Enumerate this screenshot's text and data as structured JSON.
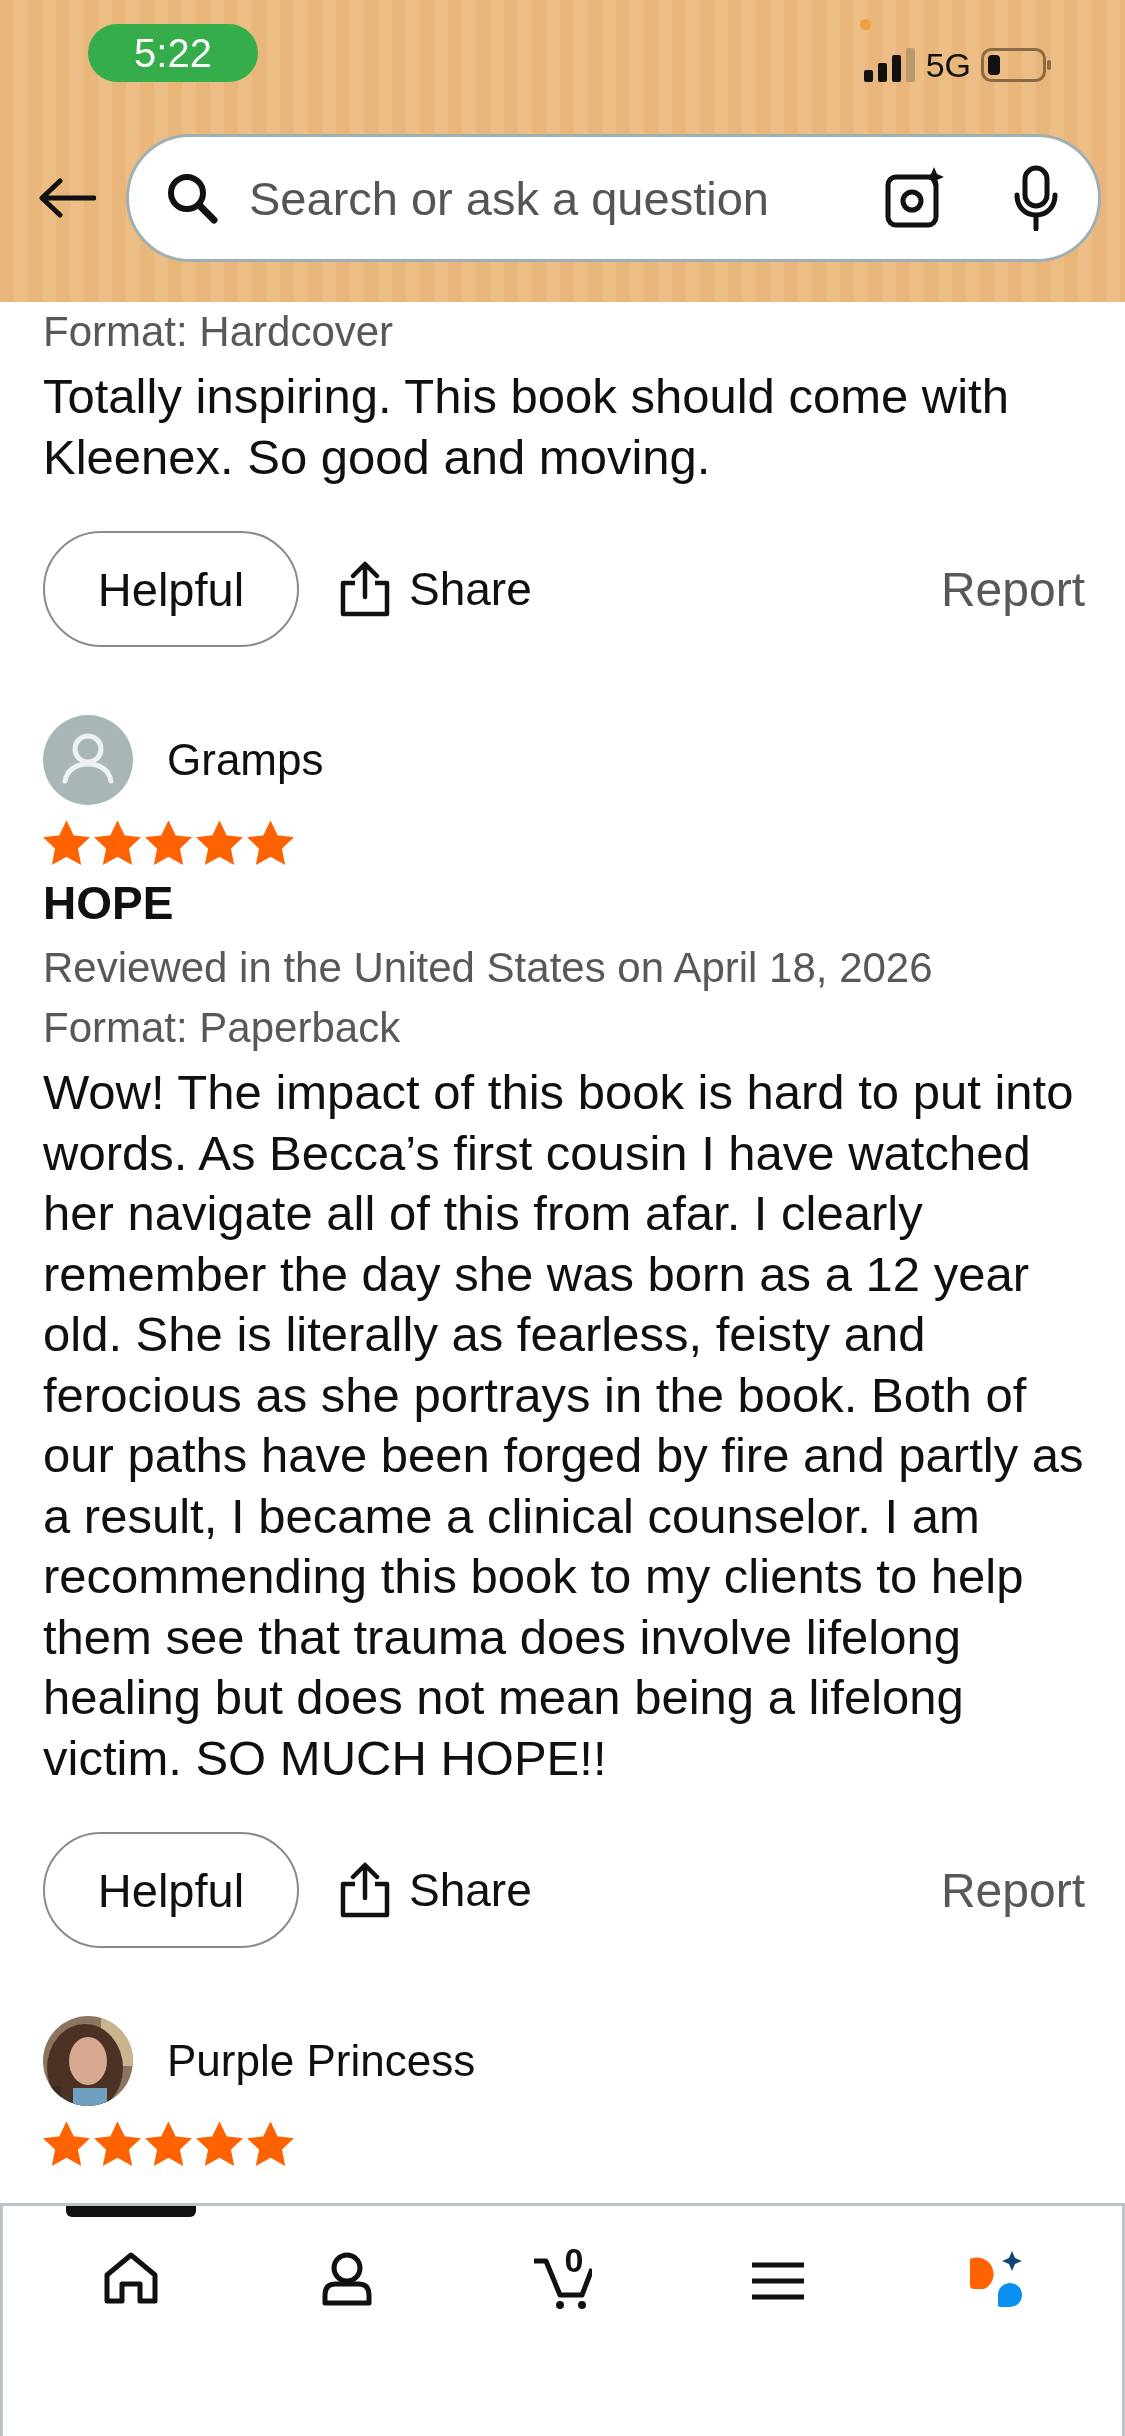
{
  "status_bar": {
    "time": "5:22",
    "network": "5G"
  },
  "search": {
    "placeholder": "Search or ask a question"
  },
  "reviews": [
    {
      "format": "Format: Hardcover",
      "body": "Totally inspiring. This book should come with Kleenex. So good and moving.",
      "actions": {
        "helpful": "Helpful",
        "share": "Share",
        "report": "Report"
      }
    },
    {
      "reviewer": "Gramps",
      "avatar": {
        "kind": "silhouette"
      },
      "stars": 5,
      "title": "HOPE",
      "meta": "Reviewed in the United States on April 18, 2026",
      "format": "Format: Paperback",
      "body": "Wow! The impact of this book is hard to put into words. As Becca’s first cousin I have watched her navigate all of this from afar. I clearly remember the day she was born as a 12 year old. She is literally as fearless, feisty and ferocious as she portrays in the book. Both of our paths have been forged by fire and partly as a result, I became a clinical counselor. I am recommending this book to my clients to help them see that trauma does involve lifelong healing but does not mean being a lifelong victim. SO MUCH HOPE!!",
      "actions": {
        "helpful": "Helpful",
        "share": "Share",
        "report": "Report"
      }
    },
    {
      "reviewer": "Purple Princess",
      "stars": 5
    }
  ],
  "tab_bar": {
    "cart_count": "0",
    "tabs": [
      {
        "kind": "home",
        "selected": true
      },
      {
        "kind": "account",
        "selected": false
      },
      {
        "kind": "cart",
        "selected": false
      },
      {
        "kind": "menu",
        "selected": false
      },
      {
        "kind": "assistant",
        "selected": false
      }
    ]
  }
}
